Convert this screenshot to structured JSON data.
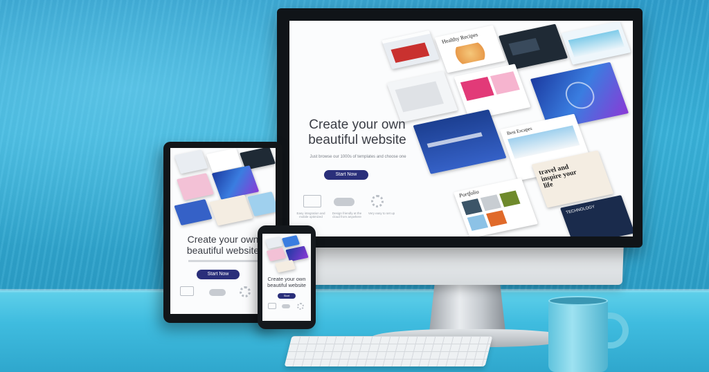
{
  "scene": {
    "description_colors": {
      "wall": "#2f9fcd",
      "desk": "#3fbcdf",
      "button": "#2a2f7a"
    }
  },
  "imac": {
    "hero_line1": "Create your own",
    "hero_line2": "beautiful website",
    "subtitle": "Just browse our 1000s of templates and choose one",
    "button": "Start Now",
    "features": [
      "Easy integration and mobile optimized",
      "Design friendly at the cloud from anywhere",
      "Very easy to set up"
    ],
    "tiles": [
      "Healthy Recipes",
      "Best Escapes",
      "travel and inspire your life",
      "Portfolio",
      "TECHNOLOGY"
    ]
  },
  "tablet": {
    "hero_line1": "Create your own",
    "hero_line2": "beautiful website",
    "button": "Start Now"
  },
  "phone": {
    "hero_line1": "Create your own",
    "hero_line2": "beautiful website",
    "button": "Start"
  }
}
